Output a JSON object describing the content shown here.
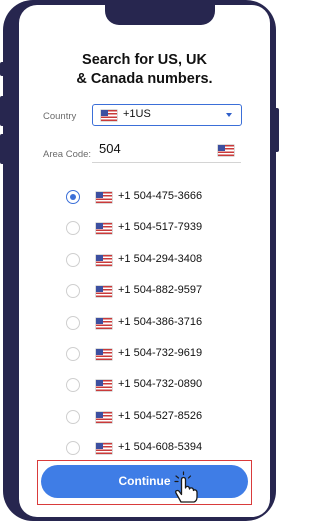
{
  "page": {
    "title_line1": "Search for US, UK",
    "title_line2": "& Canada numbers."
  },
  "country": {
    "label": "Country",
    "selected": "+1US",
    "flag_icon": "us-flag-icon"
  },
  "area_code": {
    "label": "Area Code:",
    "value": "504",
    "flag_icon": "us-flag-icon"
  },
  "numbers": [
    {
      "number": "+1 504-475-3666",
      "selected": true
    },
    {
      "number": "+1 504-517-7939",
      "selected": false
    },
    {
      "number": "+1 504-294-3408",
      "selected": false
    },
    {
      "number": "+1 504-882-9597",
      "selected": false
    },
    {
      "number": "+1 504-386-3716",
      "selected": false
    },
    {
      "number": "+1 504-732-9619",
      "selected": false
    },
    {
      "number": "+1 504-732-0890",
      "selected": false
    },
    {
      "number": "+1 504-527-8526",
      "selected": false
    },
    {
      "number": "+1 504-608-5394",
      "selected": false
    }
  ],
  "cta": {
    "label": "Continue",
    "cursor_icon": "hand-pointer-icon"
  },
  "colors": {
    "accent": "#3f7de6",
    "frame": "#27264f",
    "highlight": "#d93b3b"
  }
}
